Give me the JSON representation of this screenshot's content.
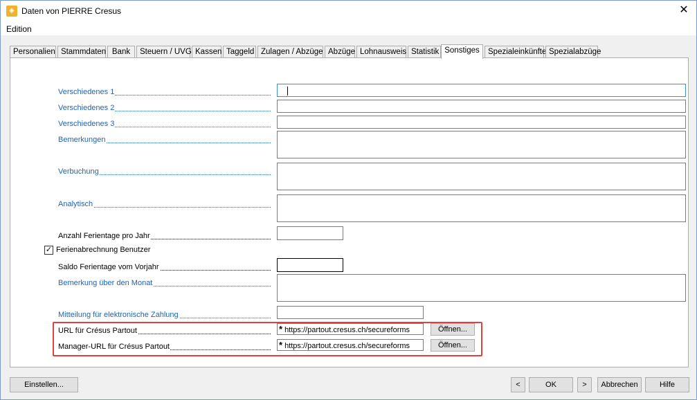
{
  "window": {
    "title": "Daten von PIERRE Cresus",
    "close_glyph": "✕"
  },
  "menu": {
    "edition": "Edition"
  },
  "tabs": [
    {
      "label": "Personalien"
    },
    {
      "label": "Stammdaten"
    },
    {
      "label": "Bank"
    },
    {
      "label": "Steuern / UVG"
    },
    {
      "label": "Kassen"
    },
    {
      "label": "Taggeld"
    },
    {
      "label": "Zulagen / Abzüge"
    },
    {
      "label": "Abzüge"
    },
    {
      "label": "Lohnausweis"
    },
    {
      "label": "Statistik"
    },
    {
      "label": "Sonstiges",
      "active": true
    },
    {
      "label": "Spezialeinkünfte"
    },
    {
      "label": "Spezialabzüge"
    }
  ],
  "form": {
    "verschiedenes1": {
      "label": "Verschiedenes 1",
      "value": ""
    },
    "verschiedenes2": {
      "label": "Verschiedenes 2",
      "value": ""
    },
    "verschiedenes3": {
      "label": "Verschiedenes 3",
      "value": ""
    },
    "bemerkungen": {
      "label": "Bemerkungen",
      "value": ""
    },
    "verbuchung": {
      "label": "Verbuchung",
      "value": ""
    },
    "analytisch": {
      "label": "Analytisch",
      "value": ""
    },
    "ferientage": {
      "label": "Anzahl Ferientage pro Jahr",
      "value": ""
    },
    "ferienabrechnung": {
      "label": "Ferienabrechnung Benutzer",
      "checked": true,
      "check_glyph": "✓"
    },
    "saldo": {
      "label": "Saldo Ferientage vom Vorjahr",
      "value": ""
    },
    "bemerkung_monat": {
      "label": "Bemerkung über den Monat",
      "value": ""
    },
    "mitteilung": {
      "label": "Mitteilung für elektronische Zahlung",
      "value": ""
    },
    "url_partout": {
      "label": "URL für Crésus Partout",
      "value": "https://partout.cresus.ch/secureforms",
      "required_mark": "*",
      "button": "Öffnen..."
    },
    "manager_url": {
      "label": "Manager-URL für Crésus Partout",
      "value": "https://partout.cresus.ch/secureforms",
      "required_mark": "*",
      "button": "Öffnen..."
    }
  },
  "footer": {
    "einstellen": "Einstellen...",
    "prev": "<",
    "ok": "OK",
    "next": ">",
    "abbrechen": "Abbrechen",
    "hilfe": "Hilfe"
  },
  "colors": {
    "link_blue": "#1e64b4",
    "highlight": "#e04040",
    "focus": "#3c8ed8"
  }
}
